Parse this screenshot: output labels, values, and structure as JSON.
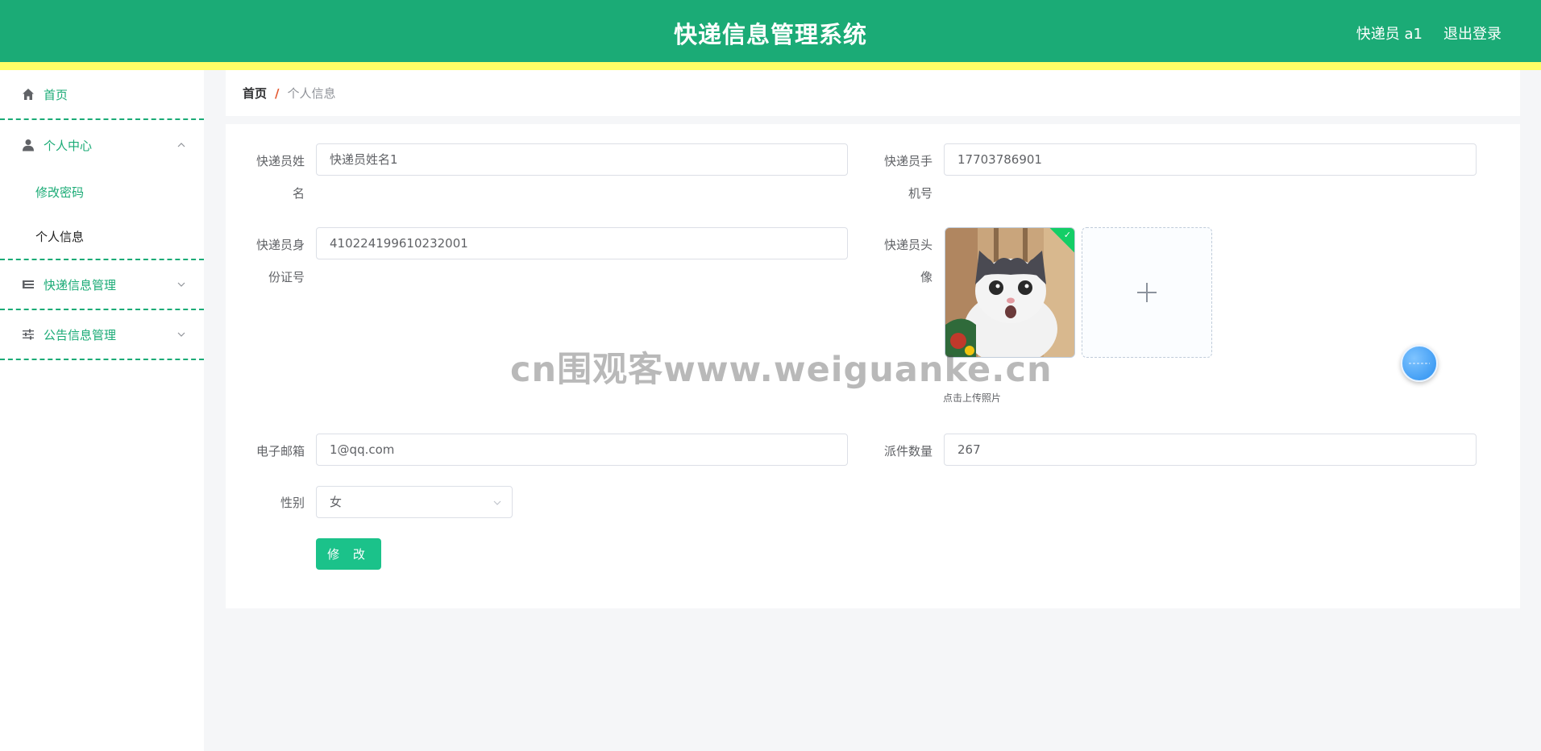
{
  "header": {
    "title": "快递信息管理系统",
    "user": "快递员 a1",
    "logout": "退出登录"
  },
  "sidebar": {
    "home": "首页",
    "personal_center": "个人中心",
    "change_password": "修改密码",
    "personal_info": "个人信息",
    "express_management": "快递信息管理",
    "notice_management": "公告信息管理"
  },
  "breadcrumb": {
    "home": "首页",
    "separator": "/",
    "current": "个人信息"
  },
  "form": {
    "name_label": "快递员姓名",
    "name_value": "快递员姓名1",
    "phone_label": "快递员手机号",
    "phone_value": "17703786901",
    "id_label": "快递员身份证号",
    "id_value": "410224199610232001",
    "avatar_label": "快递员头像",
    "upload_tip": "点击上传照片",
    "email_label": "电子邮箱",
    "email_value": "1@qq.com",
    "count_label": "派件数量",
    "count_value": "267",
    "gender_label": "性别",
    "gender_value": "女",
    "submit": "修 改"
  },
  "watermark": "cn围观客www.weiguanke.cn",
  "colors": {
    "primary": "#1bab76",
    "accent_yellow": "#ffff66",
    "button": "#1bc28a"
  }
}
